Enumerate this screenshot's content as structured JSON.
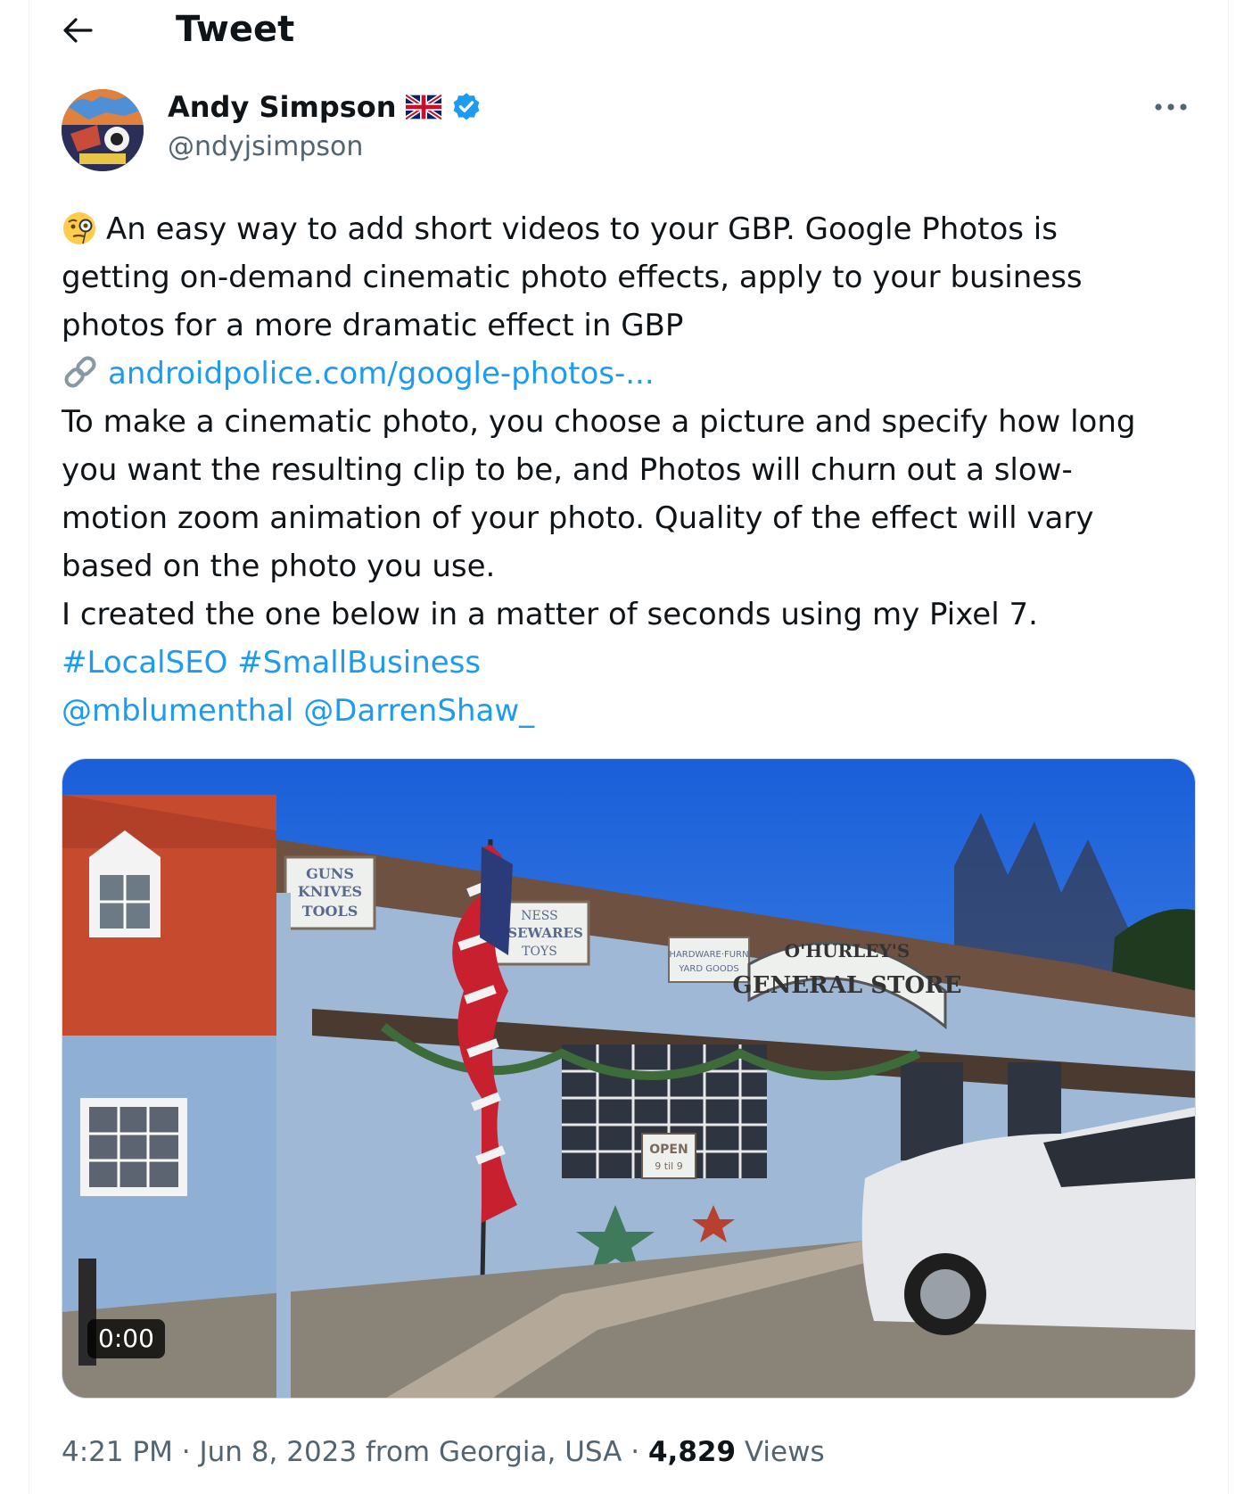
{
  "header": {
    "title": "Tweet"
  },
  "author": {
    "name": "Andy Simpson",
    "handle": "@ndyjsimpson",
    "flag": "uk-flag-icon",
    "verified": true,
    "verified_color": "#1d9bf0"
  },
  "tweet": {
    "emoji": "face-with-monocle-icon",
    "line1": "An easy way to add short videos to your GBP. Google Photos is",
    "line2": "getting on-demand cinematic photo effects, apply to your business",
    "line3": "photos for a more dramatic effect in GBP",
    "link_icon": "link-icon",
    "link_text": "androidpolice.com/google-photos-...",
    "line4": "To make a cinematic photo, you choose a picture and specify how long",
    "line5": "you want the resulting clip to be, and Photos will churn out a slow-",
    "line6": "motion zoom animation of your photo. Quality of the effect will vary",
    "line7": "based on the photo you use.",
    "line8": "I created the one below in a matter of seconds using my Pixel 7.",
    "hashtags": [
      "#LocalSEO",
      "#SmallBusiness"
    ],
    "mentions": [
      "@mblumenthal",
      "@DarrenShaw_"
    ]
  },
  "media": {
    "duration": "0:00",
    "signs": {
      "guns": "GUNS",
      "knives": "KNIVES",
      "tools": "TOOLS",
      "housewares_top": "NESS",
      "housewares": "USEWARES",
      "toys": "TOYS",
      "store_name": "O'HURLEY'S",
      "store_sub": "GENERAL STORE",
      "hardware": "HARDWARE·FURN",
      "yard": "YARD GOODS",
      "open": "OPEN",
      "hours": "9 til 9"
    }
  },
  "meta": {
    "time": "4:21 PM",
    "date": "Jun 8, 2023",
    "location": "from Georgia, USA",
    "views_count": "4,829",
    "views_label": "Views",
    "separator": "·"
  },
  "colors": {
    "link": "#1d9bf0",
    "secondary": "#536471",
    "primary": "#0f1419"
  }
}
